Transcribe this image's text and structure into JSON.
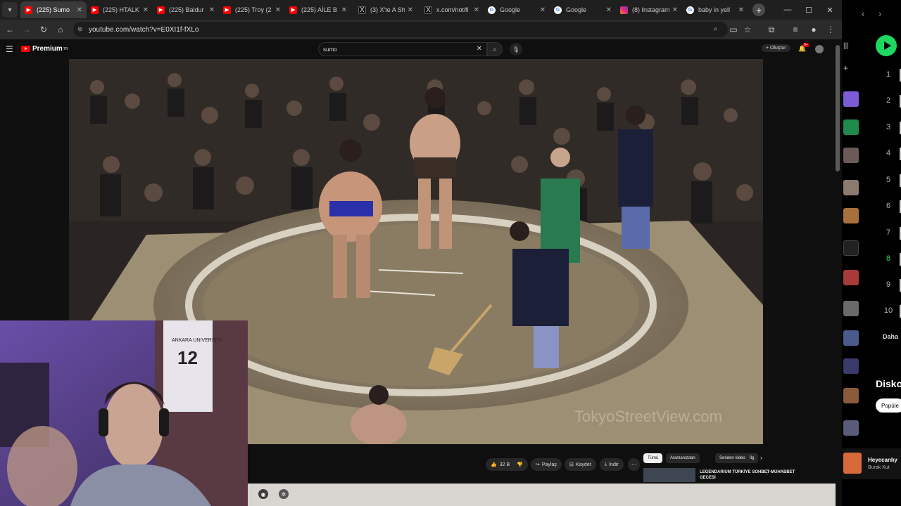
{
  "browser": {
    "tabs": [
      {
        "title": "(225) Sumo",
        "favicon": "youtube-icon",
        "active": true
      },
      {
        "title": "(225) HTALK",
        "favicon": "youtube-icon",
        "active": false
      },
      {
        "title": "(225) Baldur",
        "favicon": "youtube-icon",
        "active": false
      },
      {
        "title": "(225) Troy (2",
        "favicon": "youtube-icon",
        "active": false
      },
      {
        "title": "(225) AİLE B",
        "favicon": "youtube-icon",
        "active": false
      },
      {
        "title": "(3) X'te A Sh",
        "favicon": "x-icon",
        "active": false
      },
      {
        "title": "x.com/notifi",
        "favicon": "x-icon",
        "active": false
      },
      {
        "title": "Google",
        "favicon": "google-icon",
        "active": false
      },
      {
        "title": "Google",
        "favicon": "google-icon",
        "active": false
      },
      {
        "title": "(8) Instagram",
        "favicon": "instagram-icon",
        "active": false
      },
      {
        "title": "baby in yell",
        "favicon": "google-icon",
        "active": false
      }
    ],
    "url": "youtube.com/watch?v=E0XI1f-fXLo"
  },
  "youtube": {
    "logo_text": "Premium",
    "logo_sup": "TR",
    "search_value": "sumo",
    "create_label": "+ Oluştur",
    "notif_count": "9+",
    "actions": {
      "likes": "32 B",
      "share": "Paylaş",
      "save": "Kaydet",
      "download": "İndir"
    },
    "chips": [
      "Tümü",
      "Aramanızdan",
      "Seriden videolar",
      "İlg"
    ],
    "rec_title": "LEGENDARIUM TÜRKİYE SOHBET-MUHABBET GECESİ",
    "watermark": "TokyoStreetView.com"
  },
  "webcam": {
    "jersey_text": "ANKARA UNIVERSITY",
    "jersey_number": "12"
  },
  "spotify": {
    "numbers": [
      "1",
      "2",
      "3",
      "4",
      "5",
      "6",
      "7",
      "8",
      "9",
      "10"
    ],
    "active_number": "8",
    "more_label": "Daha",
    "section_title": "Disko",
    "chip_label": "Popüle",
    "now_playing_title": "Heyecanlıy",
    "now_playing_artist": "Burak Kut",
    "accent": "#1ed760"
  }
}
